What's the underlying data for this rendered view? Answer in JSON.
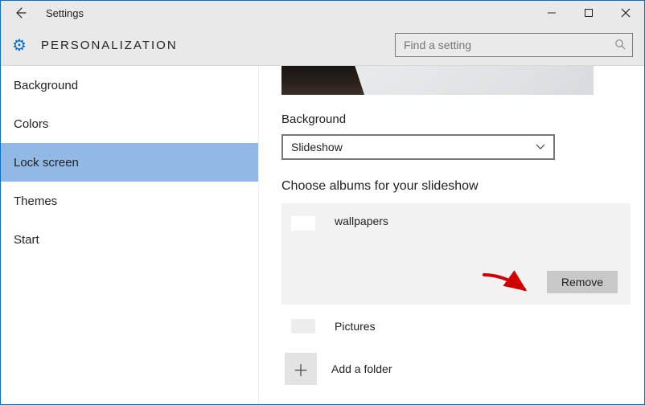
{
  "window": {
    "title": "Settings"
  },
  "header": {
    "page_title": "PERSONALIZATION"
  },
  "search": {
    "placeholder": "Find a setting"
  },
  "sidebar": {
    "items": [
      {
        "label": "Background"
      },
      {
        "label": "Colors"
      },
      {
        "label": "Lock screen",
        "selected": true
      },
      {
        "label": "Themes"
      },
      {
        "label": "Start"
      }
    ]
  },
  "main": {
    "background_label": "Background",
    "background_value": "Slideshow",
    "choose_albums_label": "Choose albums for your slideshow",
    "album_selected": {
      "name": "wallpapers",
      "remove_label": "Remove"
    },
    "other_album": {
      "name": "Pictures"
    },
    "add_folder_label": "Add a folder"
  }
}
